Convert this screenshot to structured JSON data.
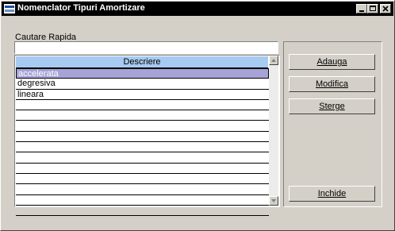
{
  "window": {
    "title": "Nomenclator Tipuri Amortizare"
  },
  "search": {
    "label": "Cautare Rapida",
    "value": ""
  },
  "grid": {
    "column_header": "Descriere",
    "rows": [
      "accelerata",
      "degresiva",
      "lineara",
      "",
      "",
      "",
      "",
      "",
      "",
      "",
      "",
      "",
      "",
      ""
    ],
    "selected_index": 0
  },
  "buttons": {
    "add": "Adauga",
    "edit": "Modifica",
    "delete": "Sterge",
    "close": "Inchide"
  },
  "icons": {
    "app": "app-icon",
    "minimize": "minimize-icon",
    "maximize": "maximize-icon",
    "close": "close-icon",
    "scroll_up": "arrow-up-icon",
    "scroll_down": "arrow-down-icon"
  }
}
